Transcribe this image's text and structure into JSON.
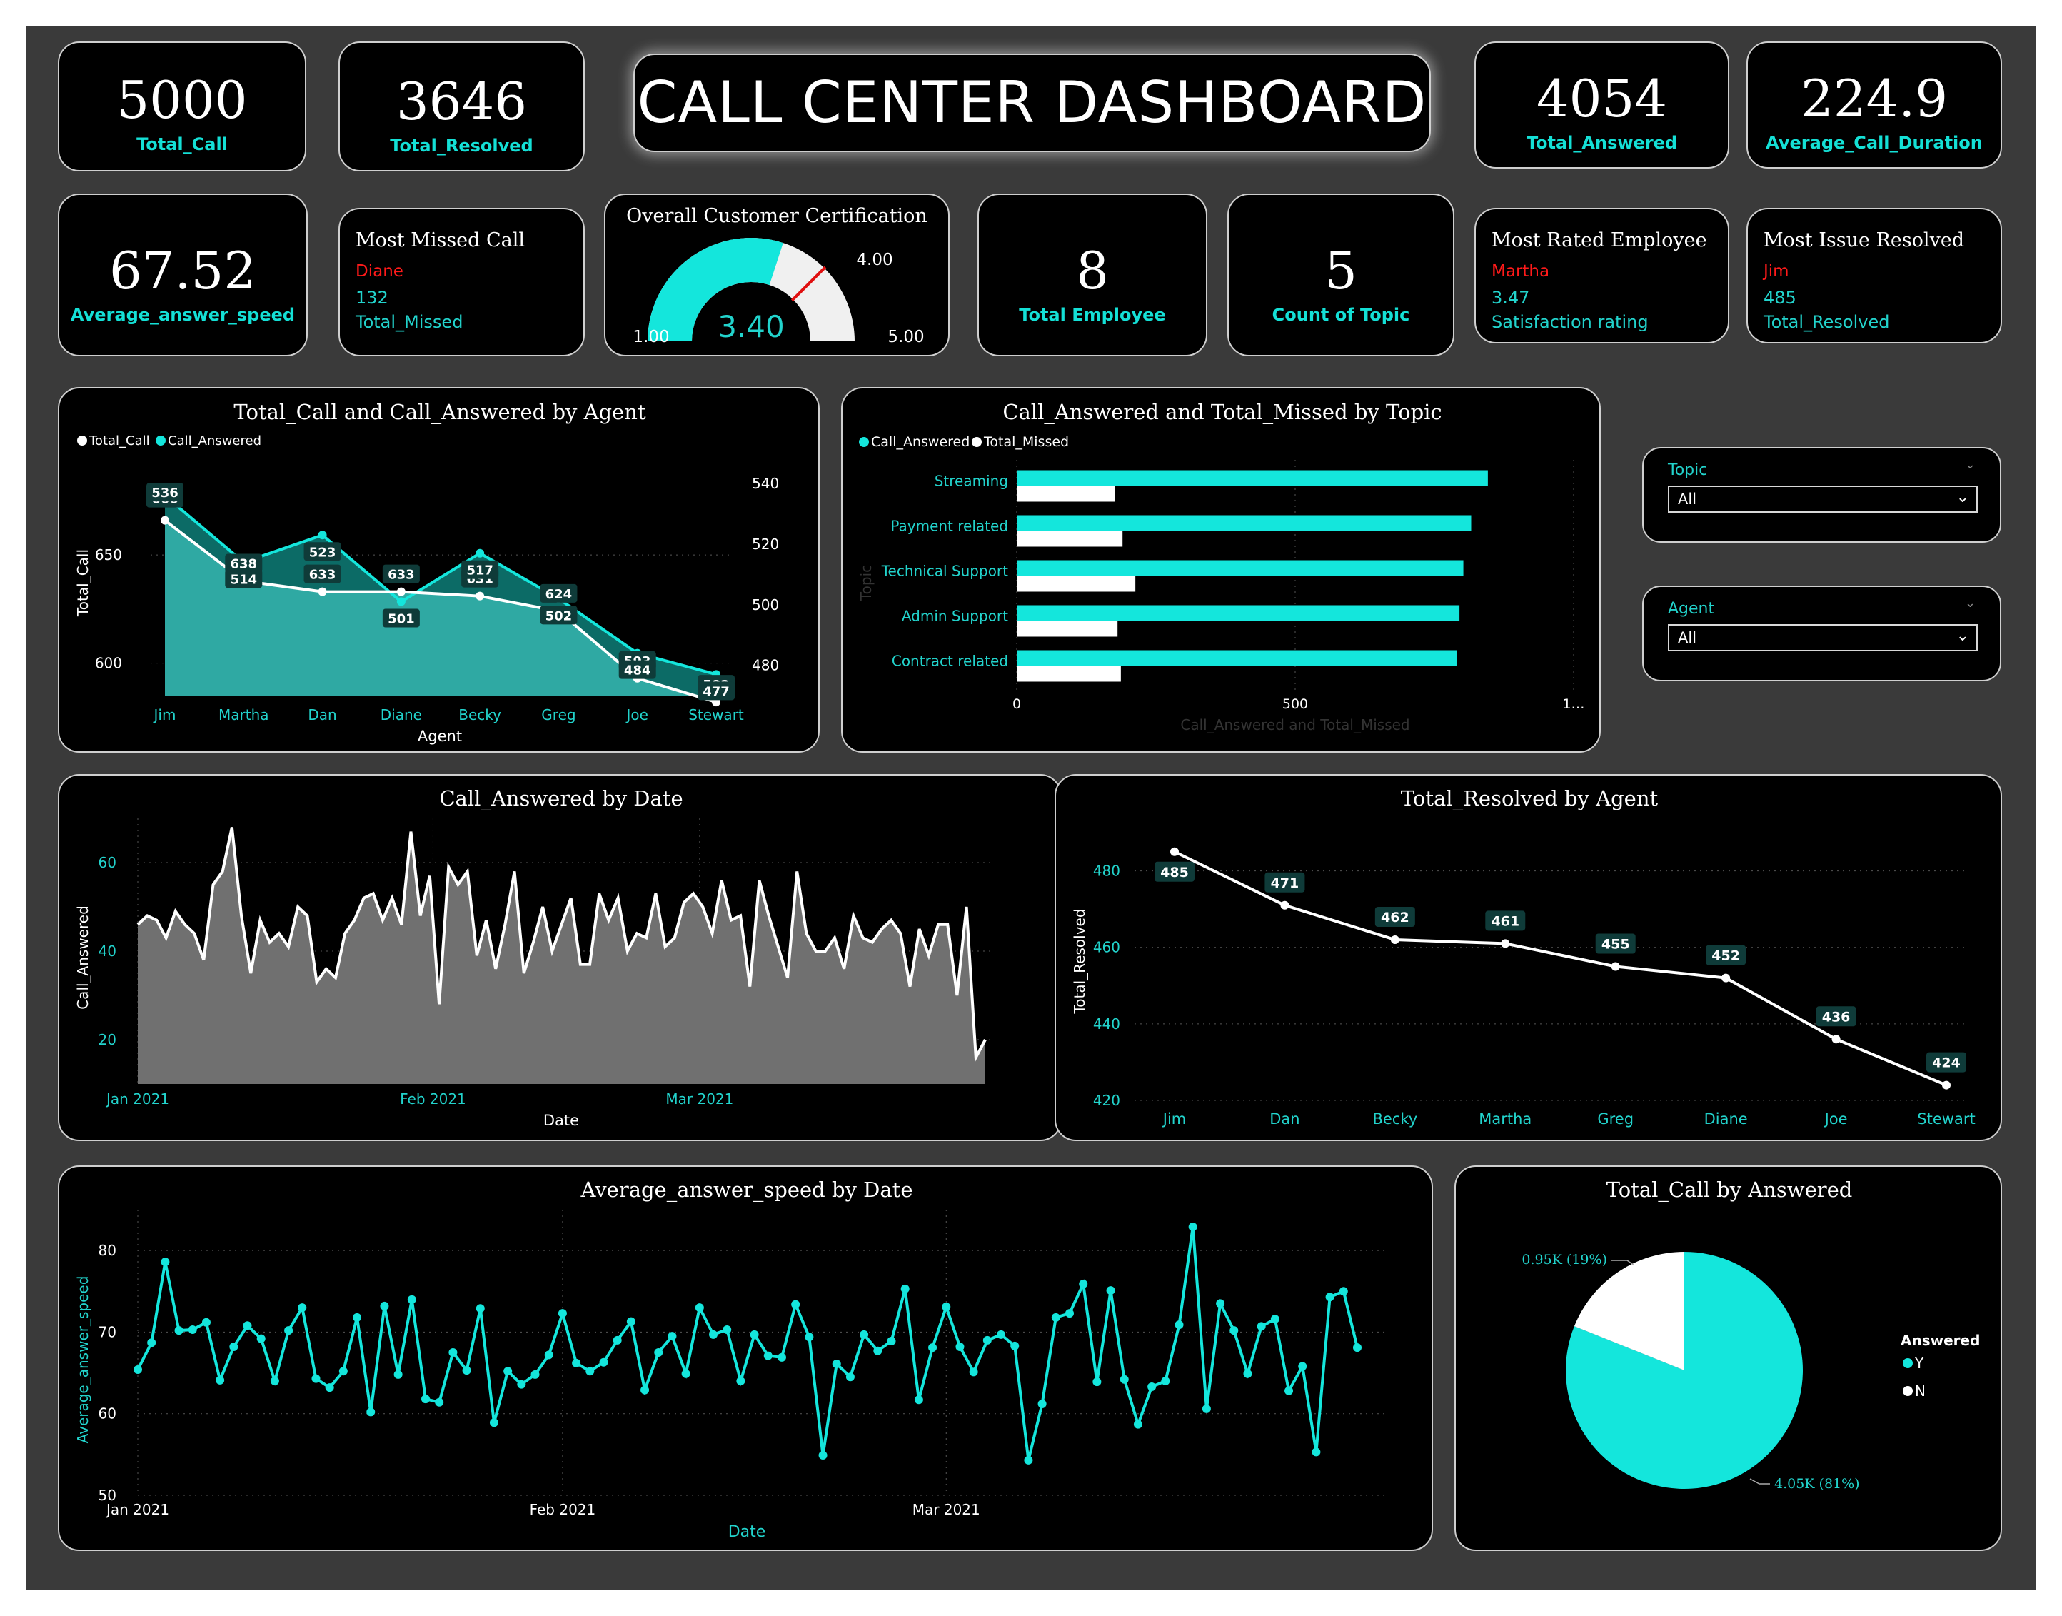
{
  "title": "CALL CENTER DASHBOARD",
  "kpis": {
    "total_call": {
      "value": "5000",
      "label": "Total_Call"
    },
    "total_resolved": {
      "value": "3646",
      "label": "Total_Resolved"
    },
    "total_answered": {
      "value": "4054",
      "label": "Total_Answered"
    },
    "avg_call_duration": {
      "value": "224.9",
      "label": "Average_Call_Duration"
    },
    "avg_answer_speed": {
      "value": "67.52",
      "label": "Average_answer_speed"
    },
    "total_employee": {
      "value": "8",
      "label": "Total Employee"
    },
    "count_topic": {
      "value": "5",
      "label": "Count of Topic"
    }
  },
  "most_missed": {
    "heading": "Most Missed Call",
    "name": "Diane",
    "value": "132",
    "label": "Total_Missed"
  },
  "most_rated": {
    "heading": "Most Rated Employee",
    "name": "Martha",
    "value": "3.47",
    "label": "Satisfaction rating"
  },
  "most_resolved": {
    "heading": "Most Issue Resolved",
    "name": "Jim",
    "value": "485",
    "label": "Total_Resolved"
  },
  "gauge": {
    "title": "Overall Customer Certification",
    "value": 3.4,
    "value_label": "3.40",
    "min": 1,
    "max": 5,
    "target": 4,
    "min_label": "1.00",
    "max_label": "5.00",
    "target_label": "4.00",
    "fill_color": "#14e6dc"
  },
  "slicers": {
    "topic": {
      "label": "Topic",
      "value": "All"
    },
    "agent": {
      "label": "Agent",
      "value": "All"
    }
  },
  "colors": {
    "accent": "#14e6dc",
    "panel": "#000000",
    "background": "#3a3a3a"
  },
  "chart_data": [
    {
      "id": "agent_combo",
      "type": "area",
      "title": "Total_Call and Call_Answered by Agent",
      "legend": [
        "Total_Call",
        "Call_Answered"
      ],
      "legend_position": "top-left",
      "xlabel": "Agent",
      "ylabel": "Total_Call",
      "y2label": "Call_Answered",
      "categories": [
        "Jim",
        "Martha",
        "Dan",
        "Diane",
        "Becky",
        "Greg",
        "Joe",
        "Stewart"
      ],
      "series": [
        {
          "name": "Total_Call",
          "axis": "left",
          "values": [
            666,
            638,
            633,
            633,
            631,
            624,
            593,
            582
          ],
          "labels": [
            "666",
            "638",
            "633",
            "633",
            "631",
            "624",
            "593",
            "582"
          ]
        },
        {
          "name": "Call_Answered",
          "axis": "right",
          "values": [
            536,
            514,
            523,
            501,
            517,
            502,
            484,
            477
          ],
          "labels": [
            "536",
            "514",
            "523",
            "501",
            "517",
            "502",
            "484",
            "477"
          ]
        }
      ],
      "y_ticks": [
        "600",
        "650"
      ],
      "y2_ticks": [
        "480",
        "500",
        "520",
        "540"
      ],
      "ylim": [
        585,
        690
      ],
      "y2lim": [
        470,
        545
      ]
    },
    {
      "id": "topic_bar",
      "type": "bar",
      "orientation": "horizontal",
      "title": "Call_Answered and Total_Missed by Topic",
      "legend": [
        "Call_Answered",
        "Total_Missed"
      ],
      "legend_position": "top-left",
      "ylabel": "Topic",
      "xlabel": "Call_Answered and Total_Missed",
      "categories": [
        "Streaming",
        "Payment related",
        "Technical Support",
        "Admin Support",
        "Contract related"
      ],
      "series": [
        {
          "name": "Call_Answered",
          "values": [
            846,
            816,
            802,
            795,
            790
          ]
        },
        {
          "name": "Total_Missed",
          "values": [
            176,
            190,
            213,
            181,
            187
          ]
        }
      ],
      "x_ticks": [
        "0",
        "500",
        "1…"
      ],
      "xlim": [
        0,
        1000
      ]
    },
    {
      "id": "answered_by_date",
      "type": "area",
      "title": "Call_Answered by Date",
      "xlabel": "Date",
      "ylabel": "Call_Answered",
      "x_ticks": [
        "Jan 2021",
        "Feb 2021",
        "Mar 2021"
      ],
      "y_ticks": [
        "20",
        "40",
        "60"
      ],
      "ylim": [
        10,
        70
      ],
      "x_start": "2021-01-01",
      "x_end": "2021-03-31",
      "values": [
        46,
        48,
        47,
        43,
        49,
        46,
        44,
        38,
        55,
        58,
        68,
        48,
        35,
        47,
        42,
        44,
        41,
        50,
        48,
        33,
        36,
        34,
        44,
        47,
        52,
        53,
        47,
        52,
        46,
        67,
        48,
        57,
        28,
        59,
        55,
        58,
        39,
        47,
        36,
        46,
        58,
        35,
        42,
        50,
        40,
        46,
        52,
        37,
        37,
        53,
        47,
        52,
        40,
        44,
        43,
        53,
        41,
        43,
        51,
        53,
        50,
        44,
        56,
        47,
        48,
        32,
        56,
        48,
        41,
        34,
        58,
        44,
        40,
        40,
        43,
        36,
        48,
        43,
        42,
        45,
        47,
        44,
        32,
        45,
        39,
        46,
        46,
        30,
        50,
        16,
        20
      ]
    },
    {
      "id": "resolved_by_agent",
      "type": "line",
      "title": "Total_Resolved by Agent",
      "ylabel": "Total_Resolved",
      "xlabel": "",
      "categories": [
        "Jim",
        "Dan",
        "Becky",
        "Martha",
        "Greg",
        "Diane",
        "Joe",
        "Stewart"
      ],
      "values": [
        485,
        471,
        462,
        461,
        455,
        452,
        436,
        424
      ],
      "labels": [
        "485",
        "471",
        "462",
        "461",
        "455",
        "452",
        "436",
        "424"
      ],
      "y_ticks": [
        "420",
        "440",
        "460",
        "480"
      ],
      "ylim": [
        420,
        490
      ]
    },
    {
      "id": "speed_by_date",
      "type": "line",
      "title": "Average_answer_speed by Date",
      "xlabel": "Date",
      "ylabel": "Average_answer_speed",
      "x_ticks": [
        "Jan 2021",
        "Feb 2021",
        "Mar 2021"
      ],
      "y_ticks": [
        "50",
        "60",
        "70",
        "80"
      ],
      "ylim": [
        50,
        85
      ],
      "x_start": "2021-01-01",
      "x_end": "2021-03-31",
      "values": [
        65.4,
        68.7,
        78.6,
        70.2,
        70.3,
        71.2,
        64.1,
        68.2,
        70.8,
        69.2,
        64.0,
        70.2,
        73.0,
        64.3,
        63.2,
        65.2,
        71.8,
        60.2,
        73.2,
        64.8,
        74.0,
        61.8,
        61.4,
        67.5,
        65.3,
        72.9,
        58.9,
        65.2,
        63.6,
        64.8,
        67.2,
        72.3,
        66.2,
        65.2,
        66.3,
        69.0,
        71.3,
        62.9,
        67.5,
        69.5,
        64.9,
        73.0,
        69.7,
        70.3,
        64.0,
        69.7,
        67.1,
        66.9,
        73.4,
        69.4,
        54.9,
        66.1,
        64.5,
        69.7,
        67.7,
        68.9,
        75.3,
        61.7,
        68.1,
        73.1,
        68.2,
        65.1,
        69.0,
        69.7,
        68.3,
        54.3,
        61.2,
        71.8,
        72.3,
        75.9,
        63.9,
        75.1,
        64.2,
        58.7,
        63.3,
        64.0,
        70.9,
        82.9,
        60.6,
        73.5,
        70.2,
        64.9,
        70.7,
        71.6,
        62.8,
        65.8,
        55.3,
        74.3,
        75.0,
        68.1
      ]
    },
    {
      "id": "call_by_answered",
      "type": "pie",
      "title": "Total_Call by Answered",
      "legend_title": "Answered",
      "legend_position": "right",
      "slices": [
        {
          "name": "Y",
          "value": 4054,
          "label": "4.05K (81%)",
          "color": "#14e6dc"
        },
        {
          "name": "N",
          "value": 946,
          "label": "0.95K (19%)",
          "color": "#ffffff"
        }
      ]
    }
  ]
}
